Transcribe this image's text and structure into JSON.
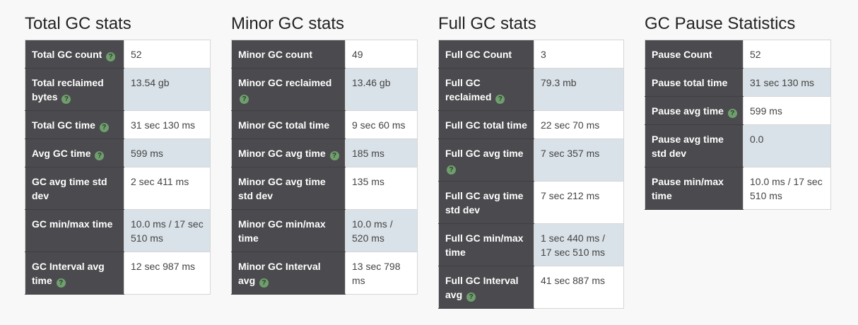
{
  "panels": [
    {
      "title": "Total GC stats",
      "rows": [
        {
          "label": "Total GC count",
          "help": true,
          "value": "52"
        },
        {
          "label": "Total reclaimed bytes",
          "help": true,
          "value": "13.54 gb"
        },
        {
          "label": "Total GC time",
          "help": true,
          "value": "31 sec 130 ms"
        },
        {
          "label": "Avg GC time",
          "help": true,
          "value": "599 ms"
        },
        {
          "label": "GC avg time std dev",
          "help": false,
          "value": "2 sec 411 ms"
        },
        {
          "label": "GC min/max time",
          "help": false,
          "value": "10.0 ms / 17 sec 510 ms"
        },
        {
          "label": "GC Interval avg time",
          "help": true,
          "value": "12 sec 987 ms"
        }
      ]
    },
    {
      "title": "Minor GC stats",
      "rows": [
        {
          "label": "Minor GC count",
          "help": false,
          "value": "49"
        },
        {
          "label": "Minor GC reclaimed",
          "help": true,
          "value": "13.46 gb"
        },
        {
          "label": "Minor GC total time",
          "help": false,
          "value": "9 sec 60 ms"
        },
        {
          "label": "Minor GC avg time",
          "help": true,
          "value": "185 ms"
        },
        {
          "label": "Minor GC avg time std dev",
          "help": false,
          "value": "135 ms"
        },
        {
          "label": "Minor GC min/max time",
          "help": false,
          "value": "10.0 ms / 520 ms"
        },
        {
          "label": "Minor GC Interval avg",
          "help": true,
          "value": "13 sec 798 ms"
        }
      ]
    },
    {
      "title": "Full GC stats",
      "rows": [
        {
          "label": "Full GC Count",
          "help": false,
          "value": "3"
        },
        {
          "label": "Full GC reclaimed",
          "help": true,
          "value": "79.3 mb"
        },
        {
          "label": "Full GC total time",
          "help": false,
          "value": "22 sec 70 ms"
        },
        {
          "label": "Full GC avg time",
          "help": true,
          "value": "7 sec 357 ms"
        },
        {
          "label": "Full GC avg time std dev",
          "help": false,
          "value": "7 sec 212 ms"
        },
        {
          "label": "Full GC min/max time",
          "help": false,
          "value": "1 sec 440 ms / 17 sec 510 ms"
        },
        {
          "label": "Full GC Interval avg",
          "help": true,
          "value": "41 sec 887 ms"
        }
      ]
    },
    {
      "title": "GC Pause Statistics",
      "rows": [
        {
          "label": "Pause Count",
          "help": false,
          "value": "52"
        },
        {
          "label": "Pause total time",
          "help": false,
          "value": "31 sec 130 ms"
        },
        {
          "label": "Pause avg time",
          "help": true,
          "value": "599 ms"
        },
        {
          "label": "Pause avg time std dev",
          "help": false,
          "value": "0.0"
        },
        {
          "label": "Pause min/max time",
          "help": false,
          "value": "10.0 ms / 17 sec 510 ms"
        }
      ]
    }
  ],
  "help_icon_glyph": "?",
  "colors": {
    "label_bg": "#4b4b4f",
    "alt_row_bg": "#d9e2e8",
    "help_icon": "#6f9f6d"
  }
}
